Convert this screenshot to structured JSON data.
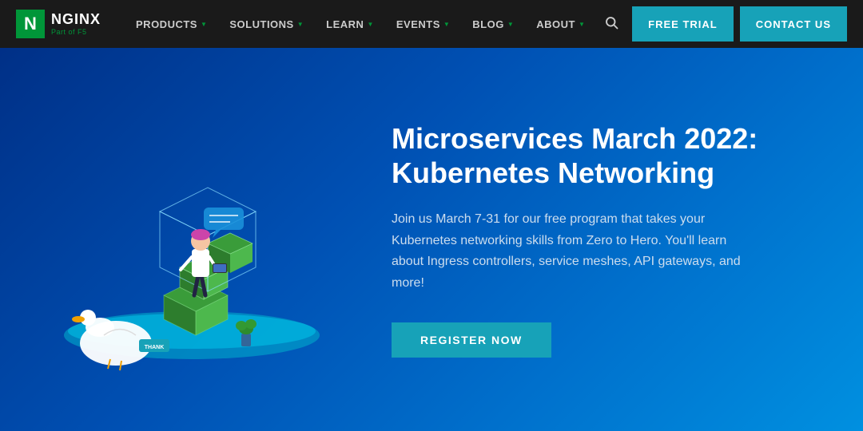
{
  "brand": {
    "logo_letter": "N",
    "name": "NGINX",
    "tagline": "Part of F5"
  },
  "nav": {
    "items": [
      {
        "label": "PRODUCTS",
        "id": "products"
      },
      {
        "label": "SOLUTIONS",
        "id": "solutions"
      },
      {
        "label": "LEARN",
        "id": "learn"
      },
      {
        "label": "EVENTS",
        "id": "events"
      },
      {
        "label": "BLOG",
        "id": "blog"
      },
      {
        "label": "ABOUT",
        "id": "about"
      }
    ],
    "search_icon": "🔍",
    "free_trial_label": "FREE TRIAL",
    "contact_label": "CONTACT US"
  },
  "hero": {
    "title": "Microservices March 2022: Kubernetes Networking",
    "description": "Join us March 7-31 for our free program that takes your Kubernetes networking skills from Zero to Hero. You'll learn about Ingress controllers, service meshes, API gateways, and more!",
    "cta_label": "REGISTER NOW"
  }
}
